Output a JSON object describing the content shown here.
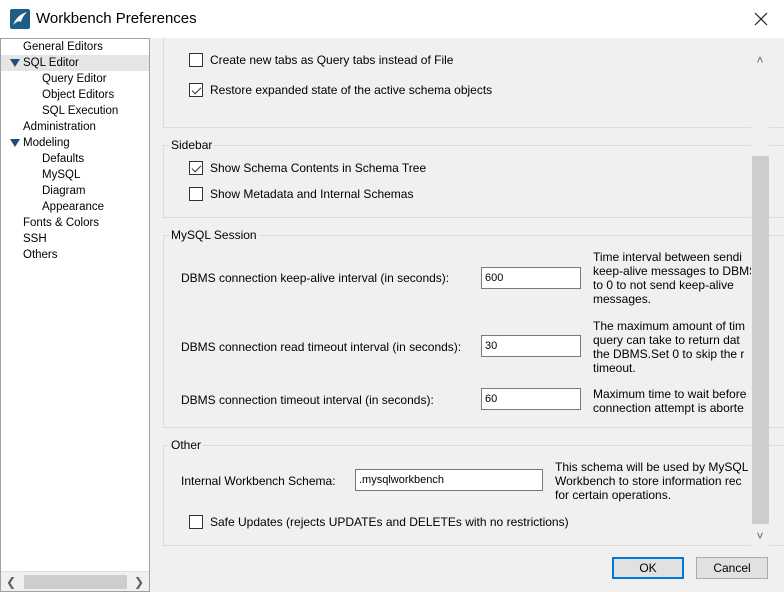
{
  "window": {
    "title": "Workbench Preferences"
  },
  "nav": {
    "items": [
      {
        "label": "General Editors"
      },
      {
        "label": "SQL Editor"
      },
      {
        "label": "Query Editor"
      },
      {
        "label": "Object Editors"
      },
      {
        "label": "SQL Execution"
      },
      {
        "label": "Administration"
      },
      {
        "label": "Modeling"
      },
      {
        "label": "Defaults"
      },
      {
        "label": "MySQL"
      },
      {
        "label": "Diagram"
      },
      {
        "label": "Appearance"
      },
      {
        "label": "Fonts & Colors"
      },
      {
        "label": "SSH"
      },
      {
        "label": "Others"
      }
    ]
  },
  "top": {
    "query_tabs": {
      "label": "Create new tabs as Query tabs instead of File",
      "checked": false
    },
    "restore_state": {
      "label": "Restore expanded state of the active schema objects",
      "checked": true
    }
  },
  "sidebar": {
    "title": "Sidebar",
    "schema_contents": {
      "label": "Show Schema Contents in Schema Tree",
      "checked": true
    },
    "metadata": {
      "label": "Show Metadata and Internal Schemas",
      "checked": false
    }
  },
  "session": {
    "title": "MySQL Session",
    "keepalive": {
      "label": "DBMS connection keep-alive interval (in seconds):",
      "value": "600",
      "desc": "Time interval between sendi\nkeep-alive messages to DBMS\nto 0 to not send keep-alive\nmessages."
    },
    "read_timeout": {
      "label": "DBMS connection read timeout interval (in seconds):",
      "value": "30",
      "desc": "The maximum amount of tim\nquery can take to return dat\nthe DBMS.Set 0 to skip the r\ntimeout."
    },
    "conn_timeout": {
      "label": "DBMS connection timeout interval (in seconds):",
      "value": "60",
      "desc": "Maximum time to wait before\nconnection attempt is aborte"
    }
  },
  "other": {
    "title": "Other",
    "schema": {
      "label": "Internal Workbench Schema:",
      "value": ".mysqlworkbench",
      "desc": "This schema will be used by MySQL\nWorkbench to store information rec\nfor certain operations."
    },
    "safe_updates": {
      "label": "Safe Updates (rejects UPDATEs and DELETEs with no restrictions)",
      "checked": false
    }
  },
  "buttons": {
    "ok": "OK",
    "cancel": "Cancel"
  },
  "icons": {
    "app": "workbench-dolphin-icon",
    "close": "close-icon"
  },
  "colors": {
    "accent": "#0078d7",
    "tree_arrow": "#1e4e79",
    "app_icon_bg": "#1f5d87"
  }
}
